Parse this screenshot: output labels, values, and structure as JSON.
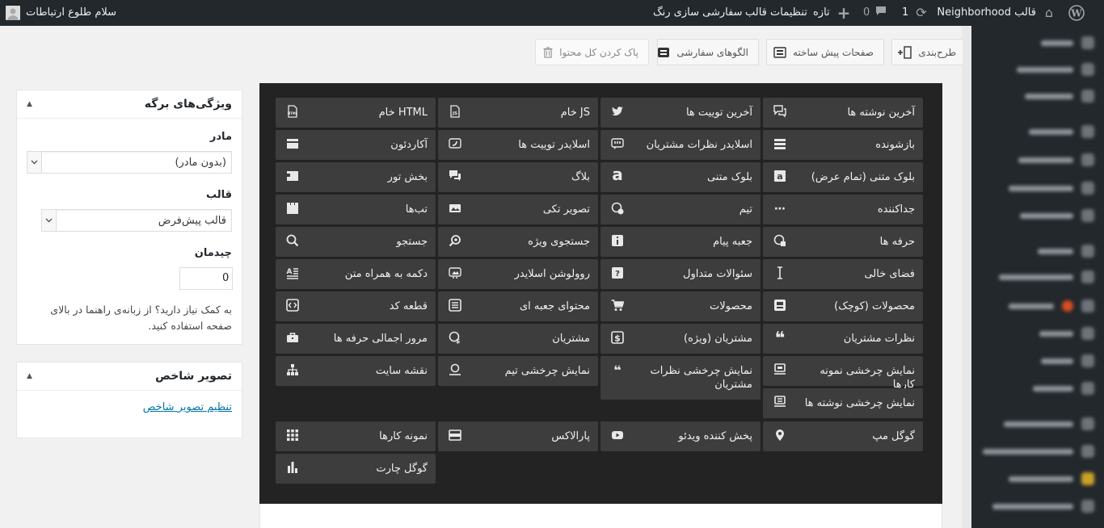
{
  "adminbar": {
    "theme_label": "قالب Neighborhood",
    "updates_count": "1",
    "comments_count": "0",
    "new_label": "تازه",
    "theme_settings": "تنظیمات قالب",
    "customize_colors": "سفارشی سازی رنگ",
    "greeting": "سلام طلوع ارتباطات"
  },
  "toolbar": {
    "layout": "طرح‌بندی",
    "prebuilt_pages": "صفحات پیش ساخته",
    "custom_patterns": "الگوهای سفارشی",
    "clear_all": "پاک کردن کل محتوا"
  },
  "elements": [
    {
      "label": "آخرین نوشته ها",
      "icon": "comments-icon"
    },
    {
      "label": "آخرین توییت ها",
      "icon": "twitter-icon"
    },
    {
      "label": "JS خام",
      "icon": "js-file-icon"
    },
    {
      "label": "HTML خام",
      "icon": "html-file-icon"
    },
    {
      "label": "بازشونده",
      "icon": "menu-icon"
    },
    {
      "label": "اسلایدر نظرات مشتریان",
      "icon": "quote-box-icon"
    },
    {
      "label": "اسلایدر توییت ها",
      "icon": "tweet-slider-icon"
    },
    {
      "label": "آکاردئون",
      "icon": "accordion-icon"
    },
    {
      "label": "بلوک متنی (تمام عرض)",
      "icon": "text-block-full-icon"
    },
    {
      "label": "بلوک متنی",
      "icon": "text-a-icon"
    },
    {
      "label": "بلاگ",
      "icon": "blog-icon"
    },
    {
      "label": "بخش تور",
      "icon": "tour-icon"
    },
    {
      "label": "جداکننده",
      "icon": "separator-icon"
    },
    {
      "label": "تیم",
      "icon": "team-icon"
    },
    {
      "label": "تصویر تکی",
      "icon": "image-icon"
    },
    {
      "label": "تب‌ها",
      "icon": "tabs-icon"
    },
    {
      "label": "حرفه ها",
      "icon": "professions-icon"
    },
    {
      "label": "جعبه پیام",
      "icon": "info-icon"
    },
    {
      "label": "جستجوی ویژه",
      "icon": "zoom-icon"
    },
    {
      "label": "جستجو",
      "icon": "search-icon"
    },
    {
      "label": "فضای خالی",
      "icon": "cursor-icon"
    },
    {
      "label": "سئوالات متداول",
      "icon": "question-icon"
    },
    {
      "label": "روولوشن اسلایدر",
      "icon": "slider-icon"
    },
    {
      "label": "دکمه به همراه متن",
      "icon": "text-button-icon"
    },
    {
      "label": "محصولات (کوچک)",
      "icon": "product-small-icon"
    },
    {
      "label": "محصولات",
      "icon": "cart-icon"
    },
    {
      "label": "محتوای جعبه ای",
      "icon": "list-box-icon"
    },
    {
      "label": "قطعه کد",
      "icon": "code-icon"
    },
    {
      "label": "نظرات مشتریان",
      "icon": "testimonial-quote-icon"
    },
    {
      "label": "مشتریان (ویژه)",
      "icon": "dollar-box-icon"
    },
    {
      "label": "مشتریان",
      "icon": "customer-icon"
    },
    {
      "label": "مرور اجمالی حرفه ها",
      "icon": "briefcase-icon"
    },
    {
      "label": "نمایش چرخشی نمونه کارها",
      "icon": "portfolio-carousel-icon"
    },
    {
      "label": "نمایش چرخشی نظرات مشتریان",
      "icon": "testimonial-carousel-icon"
    },
    {
      "label": "نمایش چرخشی تیم",
      "icon": "team-carousel-icon"
    },
    {
      "label": "نقشه سایت",
      "icon": "sitemap-icon"
    },
    {
      "label": "نمایش چرخشی نوشته ها",
      "icon": "posts-carousel-icon"
    },
    {
      "label": "گوگل مپ",
      "icon": "map-pin-icon"
    },
    {
      "label": "پخش کننده ویدئو",
      "icon": "video-icon"
    },
    {
      "label": "پارالاکس",
      "icon": "parallax-icon"
    },
    {
      "label": "نمونه کارها",
      "icon": "grid-icon"
    },
    {
      "label": "گوگل چارت",
      "icon": "bar-chart-icon"
    }
  ],
  "page_attributes": {
    "title": "ویژگی‌های برگه",
    "parent_label": "مادر",
    "parent_value": "(بدون مادر)",
    "template_label": "قالب",
    "template_value": "قالب پیش‌فرض",
    "order_label": "چیدمان",
    "order_value": "0",
    "help_text": "به کمک نیاز دارید؟ از زبانه‌ی راهنما در بالای صفحه استفاده کنید."
  },
  "featured_image": {
    "title": "تصویر شاخص",
    "set_link": "تنظیم تصویر شاخص"
  }
}
